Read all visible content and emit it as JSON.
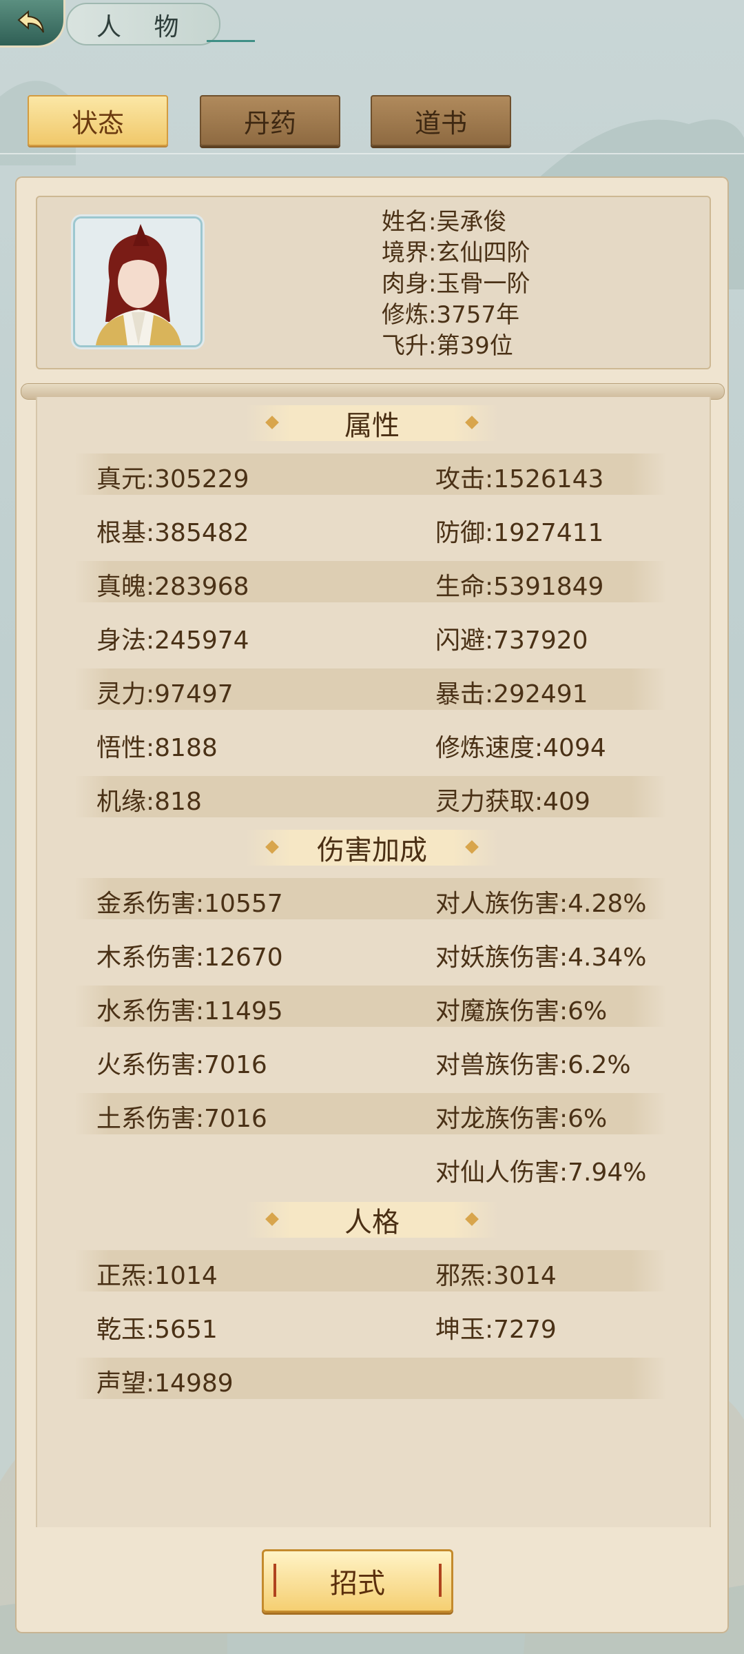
{
  "header": {
    "title": "人 物"
  },
  "tabs": [
    {
      "label": "状态",
      "active": true
    },
    {
      "label": "丹药",
      "active": false
    },
    {
      "label": "道书",
      "active": false
    }
  ],
  "character": {
    "name": "姓名:吴承俊",
    "realm": "境界:玄仙四阶",
    "body": "肉身:玉骨一阶",
    "cultivation": "修炼:3757年",
    "ascension": "飞升:第39位"
  },
  "attributes": {
    "heading": "属性",
    "rows": [
      [
        "真元:305229",
        "攻击:1526143"
      ],
      [
        "根基:385482",
        "防御:1927411"
      ],
      [
        "真魄:283968",
        "生命:5391849"
      ],
      [
        "身法:245974",
        "闪避:737920"
      ],
      [
        "灵力:97497",
        "暴击:292491"
      ],
      [
        "悟性:8188",
        "修炼速度:4094"
      ],
      [
        "机缘:818",
        "灵力获取:409"
      ]
    ]
  },
  "damage": {
    "heading": "伤害加成",
    "rows": [
      [
        "金系伤害:10557",
        "对人族伤害:4.28%"
      ],
      [
        "木系伤害:12670",
        "对妖族伤害:4.34%"
      ],
      [
        "水系伤害:11495",
        "对魔族伤害:6%"
      ],
      [
        "火系伤害:7016",
        "对兽族伤害:6.2%"
      ],
      [
        "土系伤害:7016",
        "对龙族伤害:6%"
      ],
      [
        "",
        "对仙人伤害:7.94%"
      ]
    ]
  },
  "personality": {
    "heading": "人格",
    "rows": [
      [
        "正炁:1014",
        "邪炁:3014"
      ],
      [
        "乾玉:5651",
        "坤玉:7279"
      ],
      [
        "声望:14989",
        ""
      ]
    ]
  },
  "footer": {
    "button_label": "招式"
  },
  "icons": {
    "back": "back-arrow-icon",
    "avatar": "character-portrait"
  }
}
